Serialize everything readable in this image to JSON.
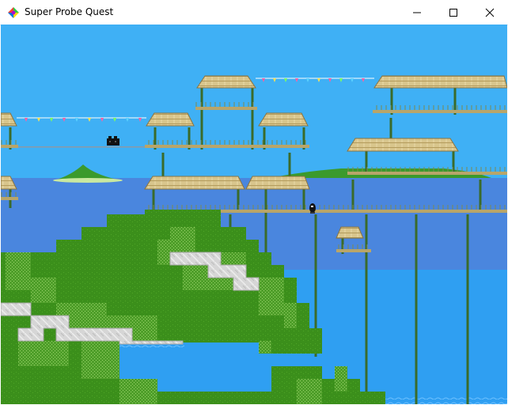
{
  "window": {
    "title": "Super Probe Quest",
    "controls": {
      "minimize": "minimize",
      "maximize": "maximize",
      "close": "close"
    }
  },
  "colors": {
    "sky": "#3fb0f5",
    "sea": "#4a86de",
    "lagoon": "#2f9ff2",
    "grass": "#3b8f1b",
    "grass_light": "#58b32e",
    "path": "#d8d8d8",
    "wood": "#d8c58c",
    "pole": "#3a6b2a"
  },
  "game": {
    "icons": [
      "player-probe-icon",
      "enemy-car-icon"
    ]
  }
}
